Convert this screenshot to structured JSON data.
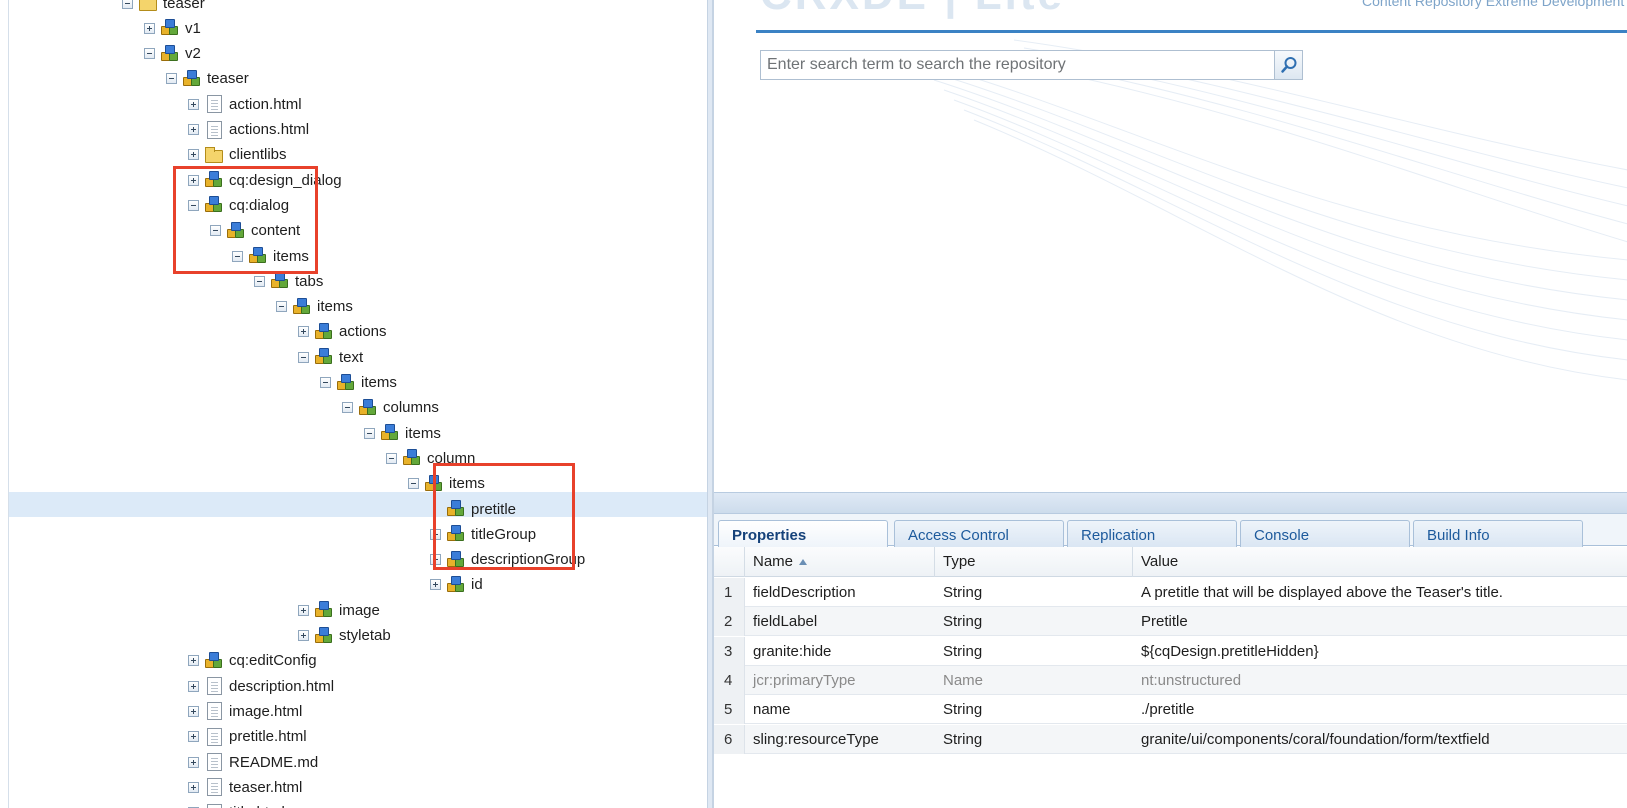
{
  "tree": {
    "nodes": [
      {
        "label": "teaser",
        "icon": "folder",
        "toggle": "minus"
      },
      {
        "label": "v1",
        "icon": "node",
        "toggle": "plus"
      },
      {
        "label": "v2",
        "icon": "node",
        "toggle": "minus"
      },
      {
        "label": "teaser",
        "icon": "node",
        "toggle": "minus"
      },
      {
        "label": "action.html",
        "icon": "file",
        "toggle": "plus"
      },
      {
        "label": "actions.html",
        "icon": "file",
        "toggle": "plus"
      },
      {
        "label": "clientlibs",
        "icon": "folder",
        "toggle": "plus"
      },
      {
        "label": "cq:design_dialog",
        "icon": "node",
        "toggle": "plus"
      },
      {
        "label": "cq:dialog",
        "icon": "node",
        "toggle": "minus"
      },
      {
        "label": "content",
        "icon": "node",
        "toggle": "minus"
      },
      {
        "label": "items",
        "icon": "node",
        "toggle": "minus"
      },
      {
        "label": "tabs",
        "icon": "node",
        "toggle": "minus"
      },
      {
        "label": "items",
        "icon": "node",
        "toggle": "minus"
      },
      {
        "label": "actions",
        "icon": "node",
        "toggle": "plus"
      },
      {
        "label": "text",
        "icon": "node",
        "toggle": "minus"
      },
      {
        "label": "items",
        "icon": "node",
        "toggle": "minus"
      },
      {
        "label": "columns",
        "icon": "node",
        "toggle": "minus"
      },
      {
        "label": "items",
        "icon": "node",
        "toggle": "minus"
      },
      {
        "label": "column",
        "icon": "node",
        "toggle": "minus"
      },
      {
        "label": "items",
        "icon": "node",
        "toggle": "minus"
      },
      {
        "label": "pretitle",
        "icon": "node",
        "toggle": "none"
      },
      {
        "label": "titleGroup",
        "icon": "node",
        "toggle": "plus"
      },
      {
        "label": "descriptionGroup",
        "icon": "node",
        "toggle": "plus"
      },
      {
        "label": "id",
        "icon": "node",
        "toggle": "plus"
      },
      {
        "label": "image",
        "icon": "node",
        "toggle": "plus"
      },
      {
        "label": "styletab",
        "icon": "node",
        "toggle": "plus"
      },
      {
        "label": "cq:editConfig",
        "icon": "node",
        "toggle": "plus"
      },
      {
        "label": "description.html",
        "icon": "file",
        "toggle": "plus"
      },
      {
        "label": "image.html",
        "icon": "file",
        "toggle": "plus"
      },
      {
        "label": "pretitle.html",
        "icon": "file",
        "toggle": "plus"
      },
      {
        "label": "README.md",
        "icon": "file",
        "toggle": "plus"
      },
      {
        "label": "teaser.html",
        "icon": "file",
        "toggle": "plus"
      },
      {
        "label": "title.html",
        "icon": "file",
        "toggle": "plus"
      }
    ]
  },
  "header": {
    "logo": "CRXDE | Lite",
    "brand": "Content Repository Extreme Development Environment"
  },
  "search": {
    "placeholder": "Enter search term to search the repository",
    "icon": "search-icon"
  },
  "properties": {
    "tabs": [
      {
        "label": "Properties",
        "active": true
      },
      {
        "label": "Access Control",
        "active": false
      },
      {
        "label": "Replication",
        "active": false
      },
      {
        "label": "Console",
        "active": false
      },
      {
        "label": "Build Info",
        "active": false
      }
    ],
    "columns": {
      "name": "Name",
      "type": "Type",
      "value": "Value"
    },
    "rows": [
      {
        "num": "1",
        "name": "fieldDescription",
        "type": "String",
        "value": "A pretitle that will be displayed above the Teaser's title."
      },
      {
        "num": "2",
        "name": "fieldLabel",
        "type": "String",
        "value": "Pretitle"
      },
      {
        "num": "3",
        "name": "granite:hide",
        "type": "String",
        "value": "${cqDesign.pretitleHidden}"
      },
      {
        "num": "4",
        "name": "jcr:primaryType",
        "type": "Name",
        "value": "nt:unstructured"
      },
      {
        "num": "5",
        "name": "name",
        "type": "String",
        "value": "./pretitle"
      },
      {
        "num": "6",
        "name": "sling:resourceType",
        "type": "String",
        "value": "granite/ui/components/coral/foundation/form/textfield"
      }
    ]
  },
  "colors": {
    "highlight": "#e8412b",
    "selection": "#dceaf8",
    "accent": "#3b82c4"
  }
}
